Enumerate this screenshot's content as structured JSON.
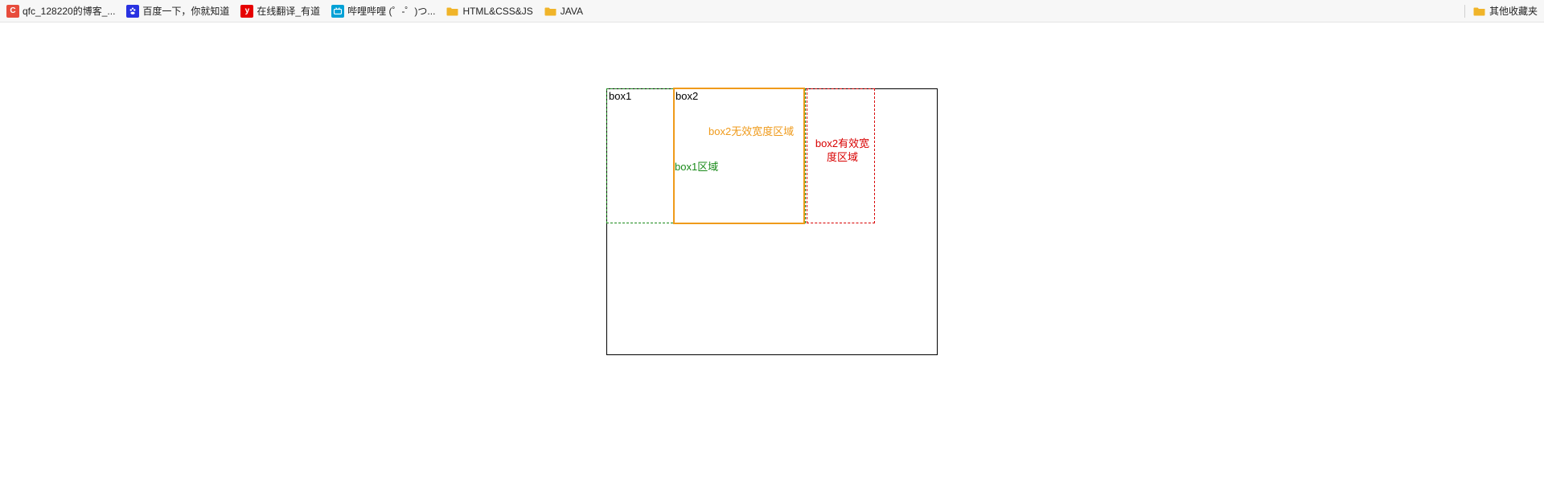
{
  "bookmarks": {
    "items": [
      {
        "icon": "c",
        "label": "qfc_128220的博客_..."
      },
      {
        "icon": "baidu",
        "label": "百度一下，你就知道"
      },
      {
        "icon": "y",
        "label": "在线翻译_有道"
      },
      {
        "icon": "bili",
        "label": "哔哩哔哩 (゜-゜)つ..."
      },
      {
        "icon": "folder",
        "label": "HTML&CSS&JS"
      },
      {
        "icon": "folder",
        "label": "JAVA"
      }
    ],
    "other_label": "其他收藏夹"
  },
  "diagram": {
    "box1_label": "box1",
    "box2_label": "box2",
    "box1_area_label": "box1区域",
    "box2_invalid_label": "box2无效宽度区域",
    "box2_valid_label": "box2有效宽度区域"
  }
}
